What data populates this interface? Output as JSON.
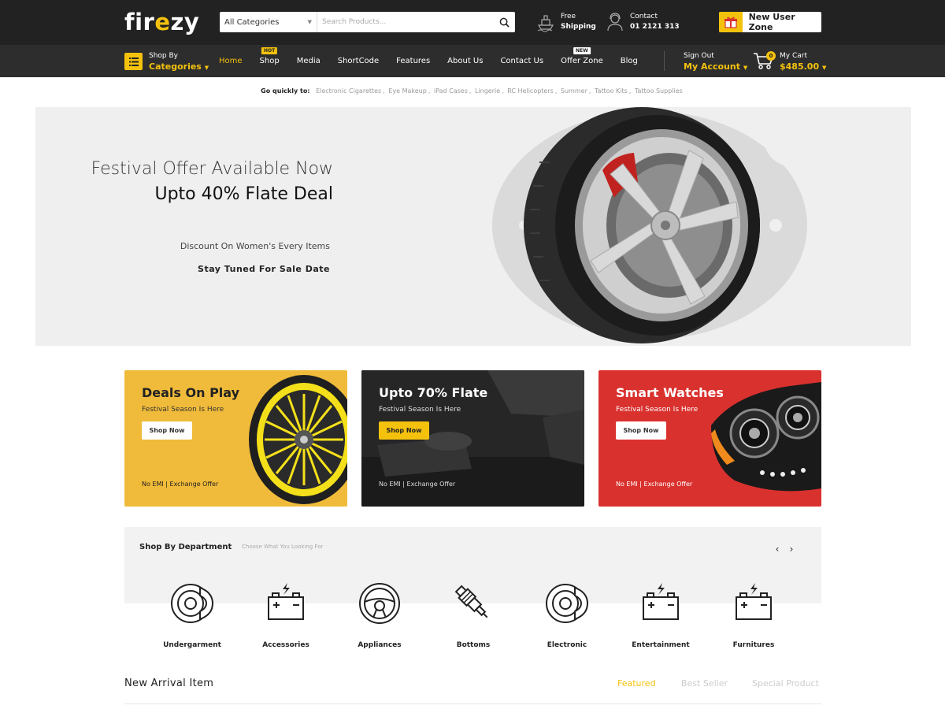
{
  "brand": {
    "logo_text_left": "fir",
    "logo_text_flame": "e",
    "logo_text_right": "zy"
  },
  "search": {
    "category": "All Categories",
    "placeholder": "Search Products..."
  },
  "header_info": {
    "shipping": {
      "line1": "Free",
      "line2": "Shipping"
    },
    "contact": {
      "line1": "Contact",
      "line2": "01 2121 313"
    }
  },
  "new_user_zone": "New User Zone",
  "categories_button": {
    "line1": "Shop By",
    "line2": "Categories"
  },
  "menu": [
    {
      "label": "Home",
      "active": true
    },
    {
      "label": "Shop",
      "badge": "HOT"
    },
    {
      "label": "Media"
    },
    {
      "label": "ShortCode"
    },
    {
      "label": "Features"
    },
    {
      "label": "About Us"
    },
    {
      "label": "Contact Us"
    },
    {
      "label": "Offer Zone",
      "badge": "NEW"
    },
    {
      "label": "Blog"
    }
  ],
  "account": {
    "line1": "Sign Out",
    "line2": "My Account"
  },
  "cart": {
    "count": "0",
    "line1": "My Cart",
    "line2": "$485.00"
  },
  "quick_links": {
    "label": "Go quickly to:",
    "links": [
      "Electronic Cigarettes",
      "Eye Makeup",
      "iPad Cases",
      "Lingerie",
      "RC Helicopters",
      "Summer",
      "Tattoo Kits",
      "Tattoo Supplies"
    ]
  },
  "hero": {
    "line1": "Festival Offer Available Now",
    "line2": "Upto 40% Flate Deal",
    "line3": "Discount On Women's Every Items",
    "line4": "Stay Tuned For Sale Date"
  },
  "promos": [
    {
      "title": "Deals On Play",
      "subtitle": "Festival Season Is Here",
      "button": "Shop Now",
      "footer": "No EMI | Exchange Offer"
    },
    {
      "title": "Upto 70% Flate",
      "subtitle": "Festival Season Is Here",
      "button": "Shop Now",
      "footer": "No EMI | Exchange Offer"
    },
    {
      "title": "Smart Watches",
      "subtitle": "Festival Season Is Here",
      "button": "Shop Now",
      "footer": "No EMI | Exchange Offer"
    }
  ],
  "department": {
    "title": "Shop By Department",
    "subtitle": "Choose What You Looking For",
    "items": [
      {
        "label": "Undergarment",
        "icon": "brake-disc-icon"
      },
      {
        "label": "Accessories",
        "icon": "car-battery-icon"
      },
      {
        "label": "Appliances",
        "icon": "steering-wheel-icon"
      },
      {
        "label": "Bottoms",
        "icon": "spark-plug-icon"
      },
      {
        "label": "Electronic",
        "icon": "brake-disc-icon"
      },
      {
        "label": "Entertainment",
        "icon": "car-battery-icon"
      },
      {
        "label": "Furnitures",
        "icon": "car-battery-icon"
      }
    ]
  },
  "new_arrival": {
    "title": "New Arrival Item",
    "tabs": [
      {
        "label": "Featured",
        "active": true
      },
      {
        "label": "Best Seller"
      },
      {
        "label": "Special Product"
      }
    ]
  },
  "colors": {
    "accent": "#f4c20d",
    "topbar": "#222222",
    "navbar": "#2d2d2d",
    "promo_yellow": "#f0bb3a",
    "promo_dark": "#2a2a2a",
    "promo_red": "#d9312e"
  }
}
